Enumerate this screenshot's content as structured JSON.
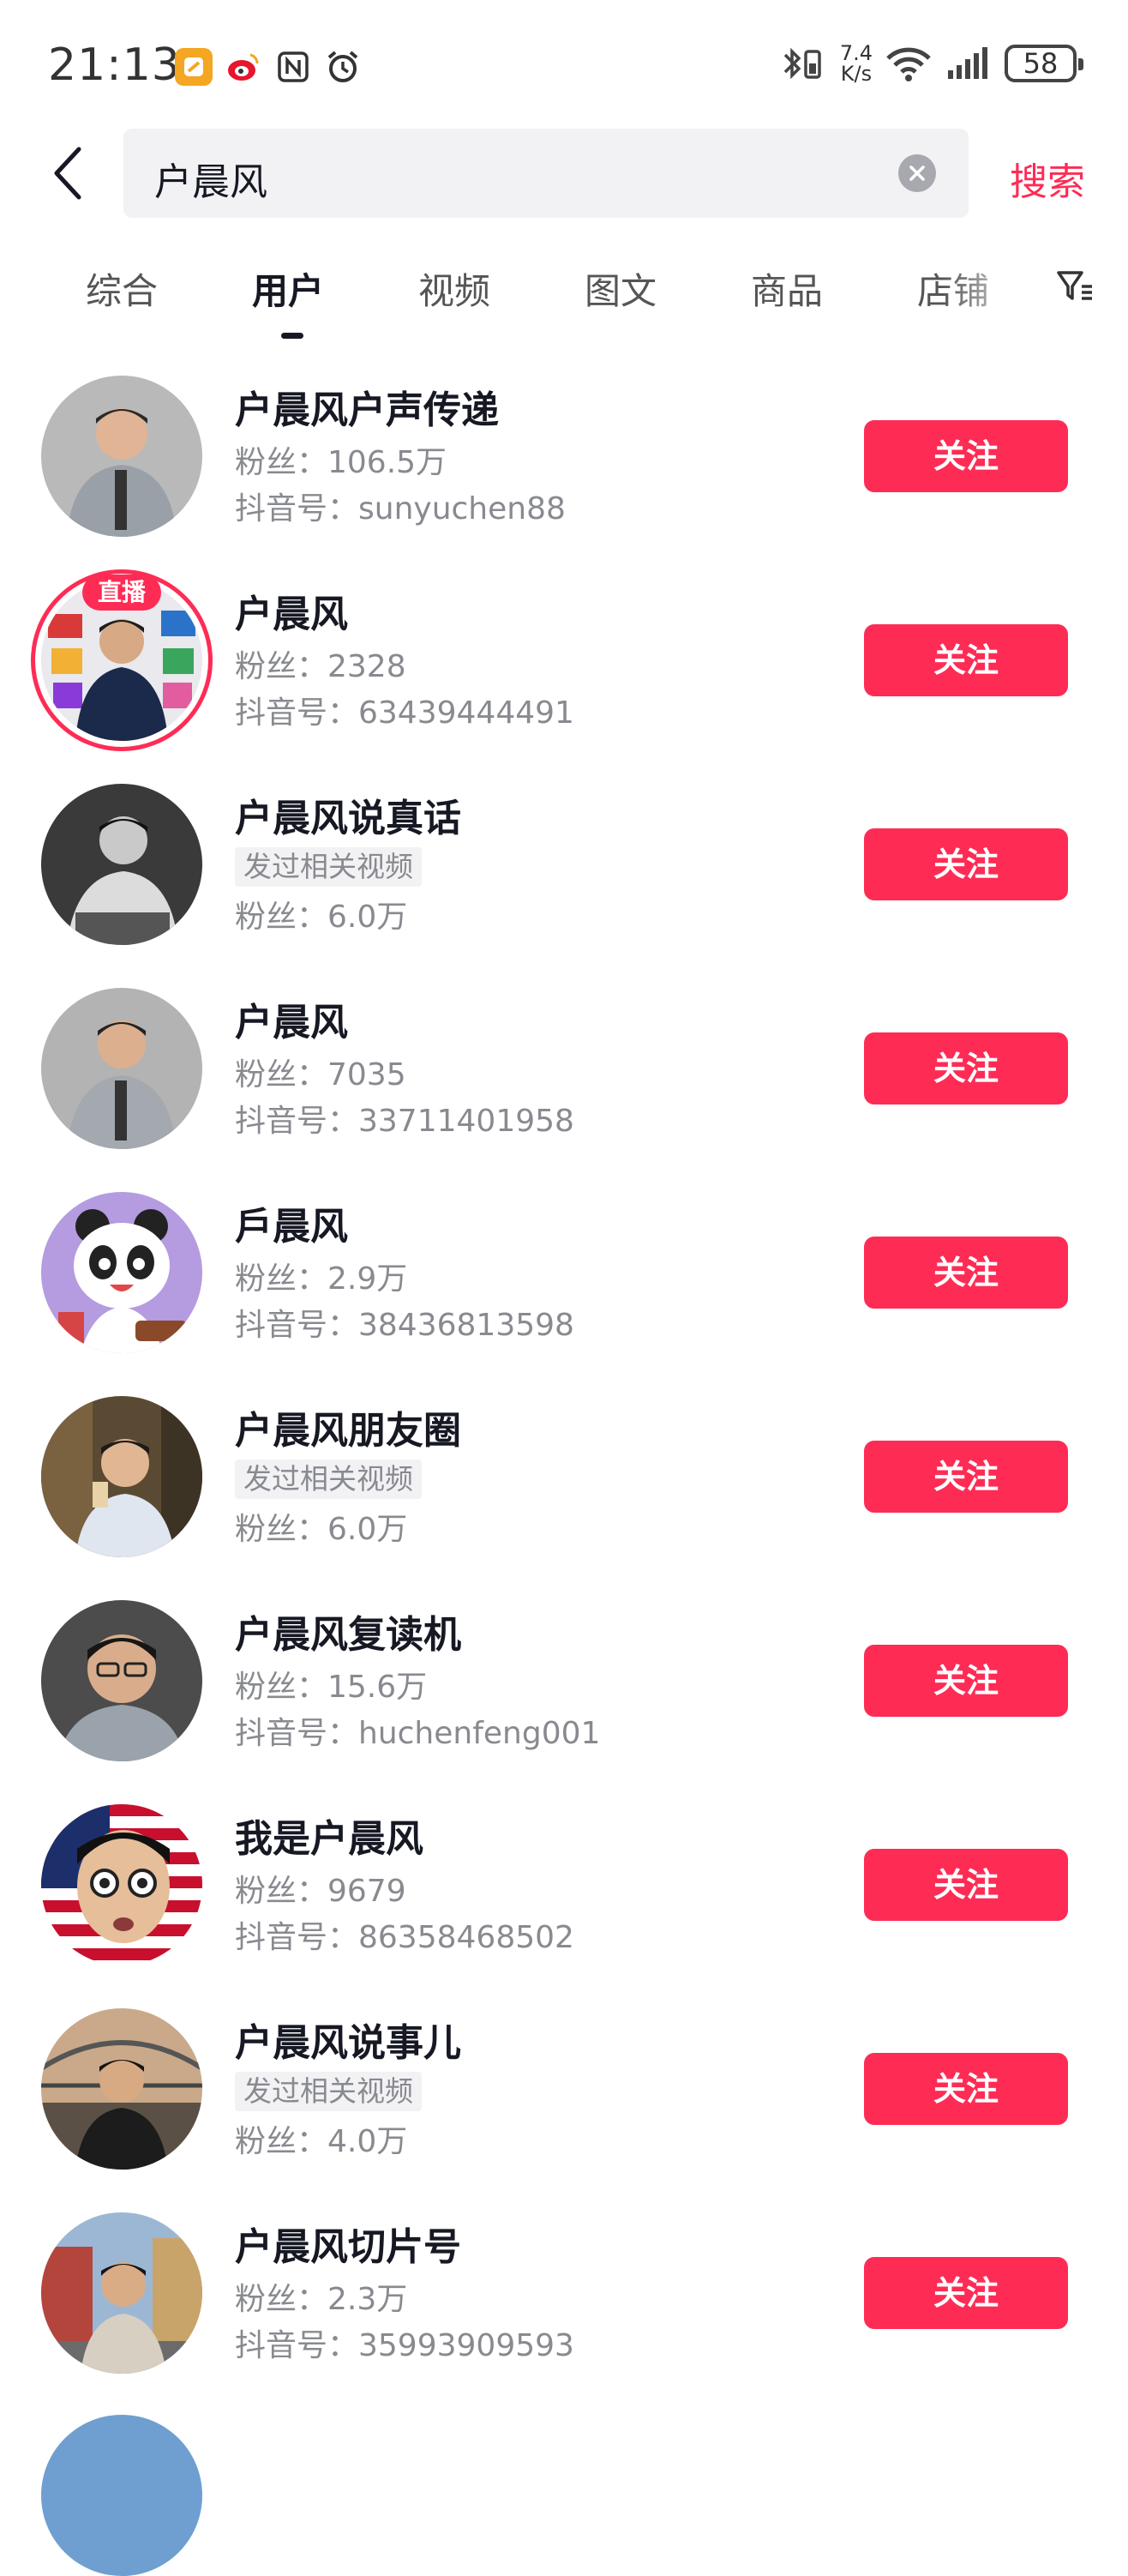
{
  "status_bar": {
    "time": "21:13",
    "net_speed_value": "7.4",
    "net_speed_unit": "K/s",
    "battery": "58"
  },
  "search": {
    "query": "户晨风",
    "submit_label": "搜索"
  },
  "tabs": [
    {
      "label": "综合",
      "active": false
    },
    {
      "label": "用户",
      "active": true
    },
    {
      "label": "视频",
      "active": false
    },
    {
      "label": "图文",
      "active": false
    },
    {
      "label": "商品",
      "active": false
    },
    {
      "label": "店铺",
      "active": false
    }
  ],
  "users": [
    {
      "name": "户晨风户声传递",
      "line2": "粉丝：106.5万",
      "line3": "抖音号：sunyuchen88",
      "tag": null,
      "live": false,
      "follow": "关注"
    },
    {
      "name": "户晨风",
      "line2": "粉丝：2328",
      "line3": "抖音号：63439444491",
      "tag": null,
      "live": true,
      "live_label": "直播",
      "follow": "关注"
    },
    {
      "name": "户晨风说真话",
      "line2": null,
      "line3": "粉丝：6.0万",
      "tag": "发过相关视频",
      "live": false,
      "follow": "关注"
    },
    {
      "name": "户晨风",
      "line2": "粉丝：7035",
      "line3": "抖音号：33711401958",
      "tag": null,
      "live": false,
      "follow": "关注"
    },
    {
      "name": "戶晨风",
      "line2": "粉丝：2.9万",
      "line3": "抖音号：38436813598",
      "tag": null,
      "live": false,
      "follow": "关注"
    },
    {
      "name": "户晨风朋友圈",
      "line2": null,
      "line3": "粉丝：6.0万",
      "tag": "发过相关视频",
      "live": false,
      "follow": "关注"
    },
    {
      "name": "户晨风复读机",
      "line2": "粉丝：15.6万",
      "line3": "抖音号：huchenfeng001",
      "tag": null,
      "live": false,
      "follow": "关注"
    },
    {
      "name": "我是户晨风",
      "line2": "粉丝：9679",
      "line3": "抖音号：86358468502",
      "tag": null,
      "live": false,
      "follow": "关注"
    },
    {
      "name": "户晨风说事儿",
      "line2": null,
      "line3": "粉丝：4.0万",
      "tag": "发过相关视频",
      "live": false,
      "follow": "关注"
    },
    {
      "name": "户晨风切片号",
      "line2": "粉丝：2.3万",
      "line3": "抖音号：35993909593",
      "tag": null,
      "live": false,
      "follow": "关注"
    }
  ],
  "colors": {
    "accent": "#fe2c55",
    "text_primary": "#161823",
    "text_secondary": "#888a90"
  }
}
